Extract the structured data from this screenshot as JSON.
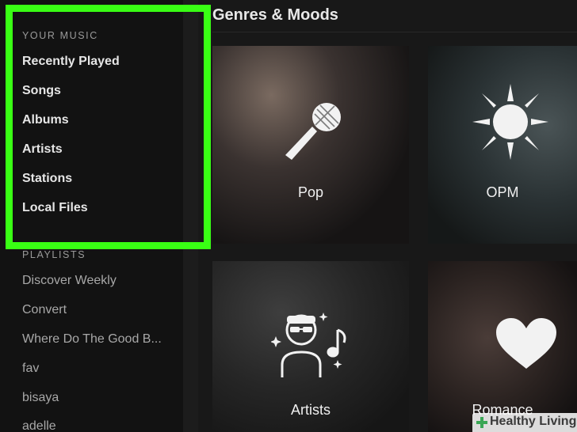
{
  "sidebar": {
    "your_music_label": "YOUR MUSIC",
    "your_music_items": [
      "Recently Played",
      "Songs",
      "Albums",
      "Artists",
      "Stations",
      "Local Files"
    ],
    "playlists_label": "PLAYLISTS",
    "playlists": [
      "Discover Weekly",
      "Convert",
      "Where Do The Good B...",
      "fav",
      "bisaya",
      "adelle"
    ]
  },
  "main": {
    "title": "Genres & Moods",
    "tiles": [
      {
        "label": "Pop",
        "icon": "microphone-icon"
      },
      {
        "label": "OPM",
        "icon": "sun-icon"
      },
      {
        "label": "Artists",
        "icon": "dj-icon"
      },
      {
        "label": "Romance",
        "icon": "heart-icon"
      }
    ]
  },
  "watermark": {
    "text": "Healthy Living"
  },
  "colors": {
    "highlight": "#39ff14",
    "background": "#181818",
    "sidebar": "#121212"
  }
}
